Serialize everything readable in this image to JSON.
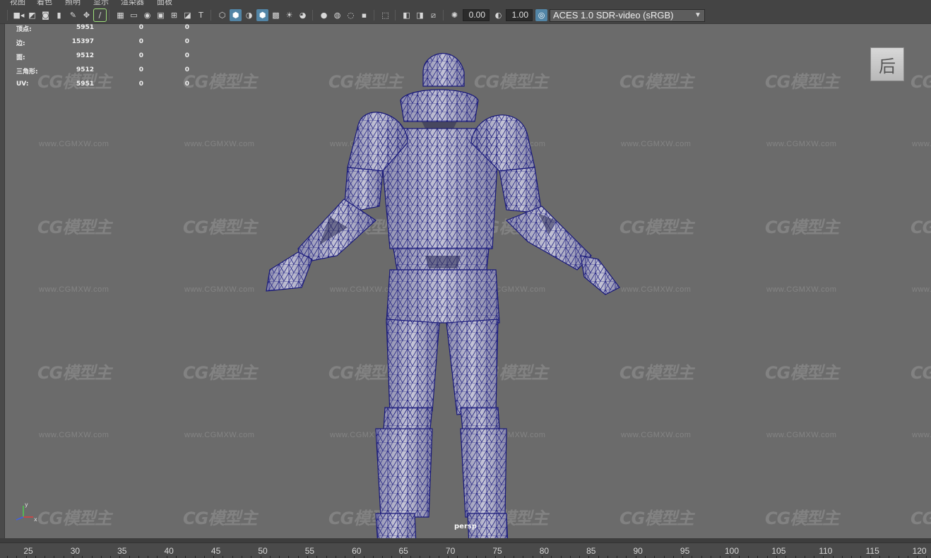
{
  "menu": {
    "items": [
      "视图",
      "着色",
      "照明",
      "显示",
      "渲染器",
      "面板"
    ]
  },
  "toolbar": {
    "icons": [
      "camera-icon",
      "camera-attributes-icon",
      "bookmark-icon",
      "image-plane-icon",
      "grease-pencil-icon",
      "2d-pan-zoom-icon",
      "grid-icon",
      "film-gate-icon",
      "resolution-gate-icon",
      "gate-mask-icon",
      "field-chart-icon",
      "safe-action-icon",
      "safe-title-icon",
      "wireframe-icon",
      "smooth-shade-icon",
      "default-material-icon",
      "wireframe-on-shaded-icon",
      "textured-icon",
      "use-all-lights-icon",
      "shadows-icon",
      "screen-space-ao-icon",
      "motion-blur-icon",
      "anti-alias-icon",
      "depth-of-field-icon",
      "isolate-select-icon",
      "xray-icon",
      "xray-joints-icon",
      "backface-culling-icon",
      "exposure-icon",
      "gamma-icon",
      "color-management-icon"
    ],
    "exposure_value": "0.00",
    "gamma_value": "1.00",
    "color_space": "ACES 1.0 SDR-video (sRGB)"
  },
  "hud": {
    "rows": [
      {
        "label": "顶点:",
        "v1": "5951",
        "v2": "0",
        "v3": "0"
      },
      {
        "label": "边:",
        "v1": "15397",
        "v2": "0",
        "v3": "0"
      },
      {
        "label": "面:",
        "v1": "9512",
        "v2": "0",
        "v3": "0"
      },
      {
        "label": "三角形:",
        "v1": "9512",
        "v2": "0",
        "v3": "0"
      },
      {
        "label": "UV:",
        "v1": "5951",
        "v2": "0",
        "v3": "0"
      }
    ]
  },
  "viewcube": {
    "face_label": "后"
  },
  "camera": {
    "name": "persp"
  },
  "axis": {
    "y": "y",
    "x": "x"
  },
  "watermark": {
    "logo": "CG模型主",
    "url": "www.CGMXW.com"
  },
  "timeline": {
    "frames": [
      "25",
      "30",
      "35",
      "40",
      "45",
      "50",
      "55",
      "60",
      "65",
      "70",
      "75",
      "80",
      "85",
      "90",
      "95",
      "100",
      "105",
      "110",
      "115",
      "120"
    ]
  },
  "colors": {
    "viewport_bg": "#6b6b6b",
    "wire": "#1a1a78",
    "active_button": "#5285a6",
    "ui_bg": "#444444"
  }
}
